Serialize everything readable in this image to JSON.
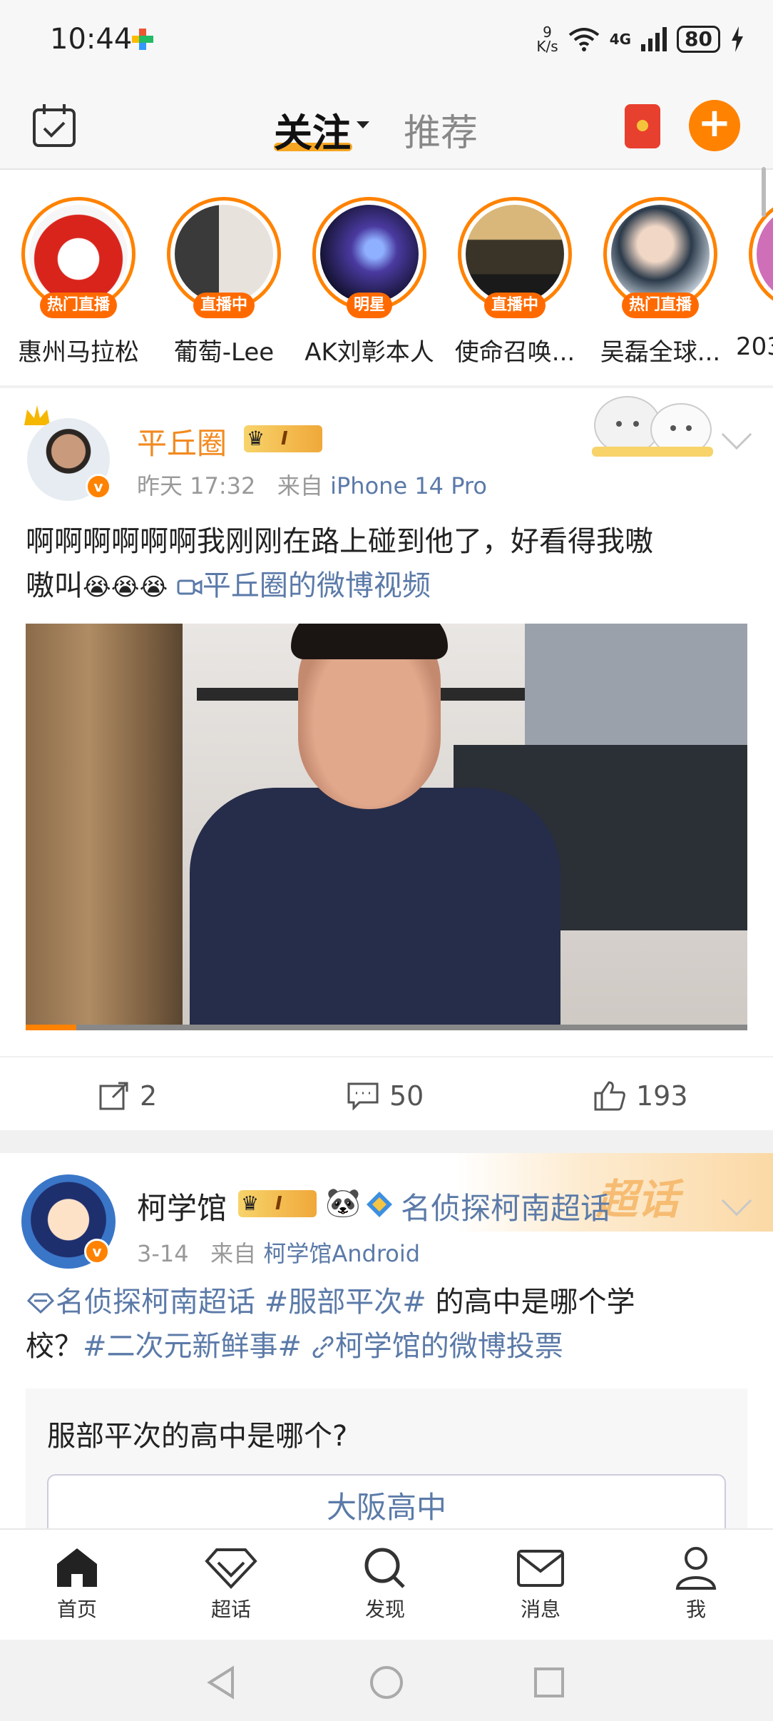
{
  "status_bar": {
    "time": "10:44",
    "speed_top": "9",
    "speed_unit": "K/s",
    "network": "4G",
    "battery": "80"
  },
  "top_nav": {
    "tab_follow": "关注",
    "tab_recommend": "推荐"
  },
  "live_row": [
    {
      "name": "惠州马拉松",
      "badge": "热门直播"
    },
    {
      "name": "葡萄-Lee",
      "badge": "直播中"
    },
    {
      "name": "AK刘彰本人",
      "badge": "明星"
    },
    {
      "name": "使命召唤...",
      "badge": "直播中"
    },
    {
      "name": "吴磊全球...",
      "badge": "热门直播"
    },
    {
      "name": "203",
      "badge": ""
    }
  ],
  "post1": {
    "author": "平丘圈",
    "time": "昨天 17:32",
    "from_label": "来自",
    "source": "iPhone 14 Pro",
    "text_line1": "啊啊啊啊啊啊我刚刚在路上碰到他了，好看得我嗷",
    "text_line2_prefix": "嗷叫",
    "emoji": "😭😭😭",
    "video_link": "平丘圈的微博视频",
    "video_progress_pct": 7,
    "reposts": "2",
    "comments": "50",
    "likes": "193"
  },
  "post2": {
    "author": "柯学馆",
    "supertopic": "名侦探柯南超话",
    "supertopic_badge": "超话",
    "time": "3-14",
    "from_label": "来自",
    "source": "柯学馆Android",
    "topic_link": "名侦探柯南超话",
    "hashtag1": "#服部平次#",
    "text_mid": " 的高中是哪个学",
    "text_line2_prefix": "校？",
    "hashtag2": "#二次元新鲜事#",
    "poll_link": "柯学馆的微博投票",
    "poll_question": "服部平次的高中是哪个?",
    "poll_option": "大阪高中"
  },
  "bottom_tabs": [
    {
      "label": "首页"
    },
    {
      "label": "超话"
    },
    {
      "label": "发现"
    },
    {
      "label": "消息"
    },
    {
      "label": "我"
    }
  ]
}
